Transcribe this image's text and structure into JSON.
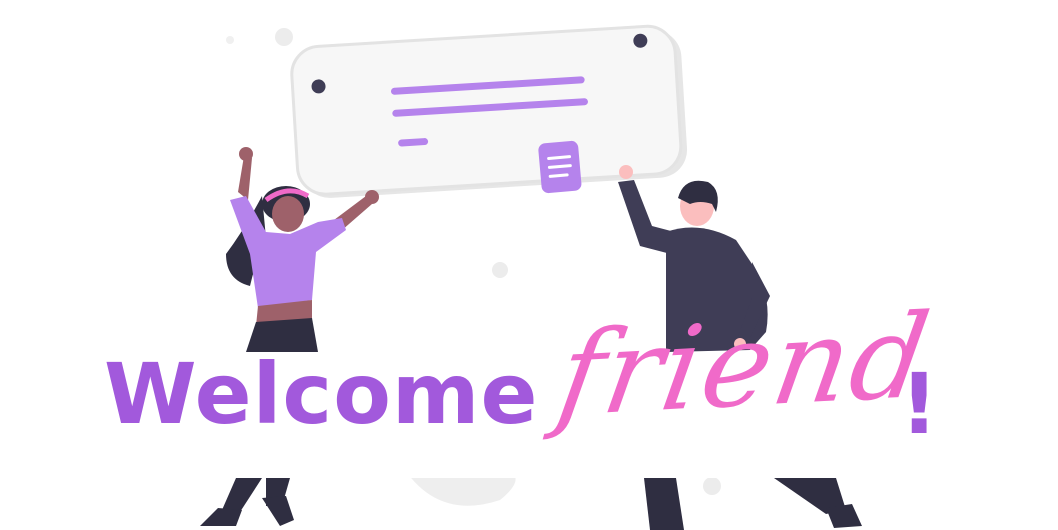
{
  "heading": {
    "word1": "Welcome",
    "word2": "friend",
    "punct": "!"
  },
  "colors": {
    "purple_text": "#a259dc",
    "pink_script": "#f06ac9",
    "accent_purple": "#b583ec",
    "dark_figure": "#3f3d56",
    "skin_dark": "#9e616a",
    "skin_light": "#fbbebe",
    "board_fill": "#f2f2f2",
    "board_stroke": "#e6e6e6"
  },
  "illustration": {
    "board_lines": 3,
    "doc_icon": "document-icon"
  }
}
